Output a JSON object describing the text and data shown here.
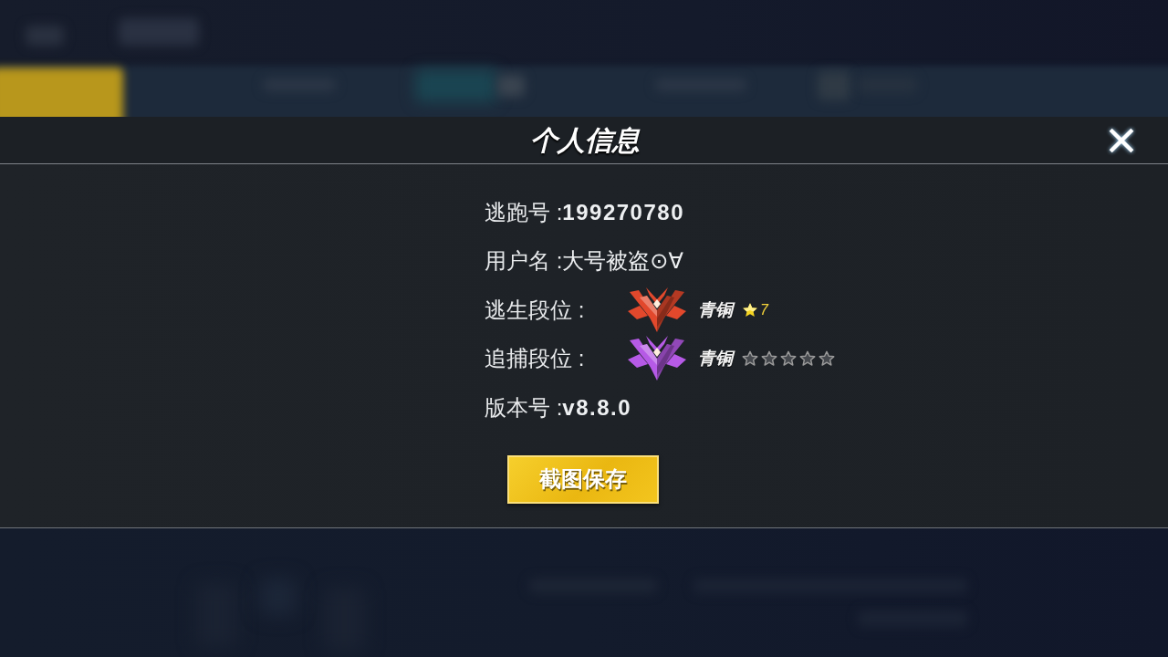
{
  "dialog": {
    "title": "个人信息",
    "fields": [
      {
        "kind": "code",
        "label": "逃跑号 :",
        "value": "199270780"
      },
      {
        "kind": "text",
        "label": "用户名 :",
        "value": "大号被盗⊙∀"
      },
      {
        "kind": "rank",
        "label": "逃生段位 :",
        "color": "#e2482c",
        "tier": "青铜",
        "rating": {
          "kind": "count",
          "count": "7"
        }
      },
      {
        "kind": "rank",
        "label": "追捕段位 :",
        "color": "#b65ae6",
        "tier": "青铜",
        "rating": {
          "kind": "stars",
          "stars": 0
        }
      },
      {
        "kind": "code",
        "label": "版本号 :",
        "value": "v8.8.0"
      }
    ],
    "button": {
      "label": "截图保存"
    }
  }
}
